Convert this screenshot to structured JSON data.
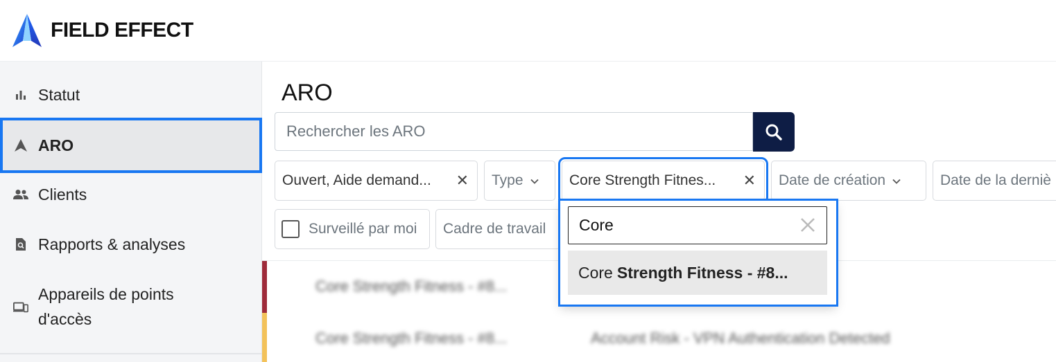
{
  "brand": {
    "name": "FIELD EFFECT"
  },
  "sidebar": {
    "items": [
      {
        "label": "Statut",
        "icon": "bar-chart-icon"
      },
      {
        "label": "ARO",
        "icon": "aro-arrow-icon",
        "active": true
      },
      {
        "label": "Clients",
        "icon": "people-icon"
      },
      {
        "label": "Rapports & analyses",
        "icon": "report-search-icon"
      },
      {
        "label": "Appareils de points d'accès",
        "label_line1": "Appareils de points",
        "label_line2": "d'accès",
        "icon": "devices-icon"
      }
    ]
  },
  "main": {
    "title": "ARO",
    "search": {
      "placeholder": "Rechercher les ARO",
      "value": "",
      "button_icon": "search-icon"
    },
    "filters": [
      {
        "label": "Ouvert, Aide demand...",
        "clearable": true
      },
      {
        "label": "Type",
        "placeholder": true,
        "dropdown": true
      },
      {
        "label": "Core Strength Fitnes...",
        "clearable": true,
        "open": true
      },
      {
        "label": "Date de création",
        "placeholder": true,
        "dropdown": true
      },
      {
        "label": "Date de la derniè",
        "placeholder": true
      }
    ],
    "watched_by_me": {
      "label": "Surveillé par moi",
      "checked": false
    },
    "framework": {
      "label": "Cadre de travail"
    },
    "dropdown": {
      "search_value": "Core",
      "options": [
        {
          "match": "Core",
          "rest": "Strength Fitness - #8..."
        }
      ]
    },
    "rows": [
      {
        "client": "Core Strength Fitness - #8...",
        "title": "",
        "severity_color": "#9e2b3a"
      },
      {
        "client": "Core Strength Fitness - #8...",
        "title": "Account Risk - VPN Authentication Detected",
        "severity_color": "#f3c25a"
      }
    ]
  },
  "colors": {
    "accent": "#1877f2",
    "search_button": "#0e1d45",
    "sidebar_bg": "#f4f5f7"
  }
}
